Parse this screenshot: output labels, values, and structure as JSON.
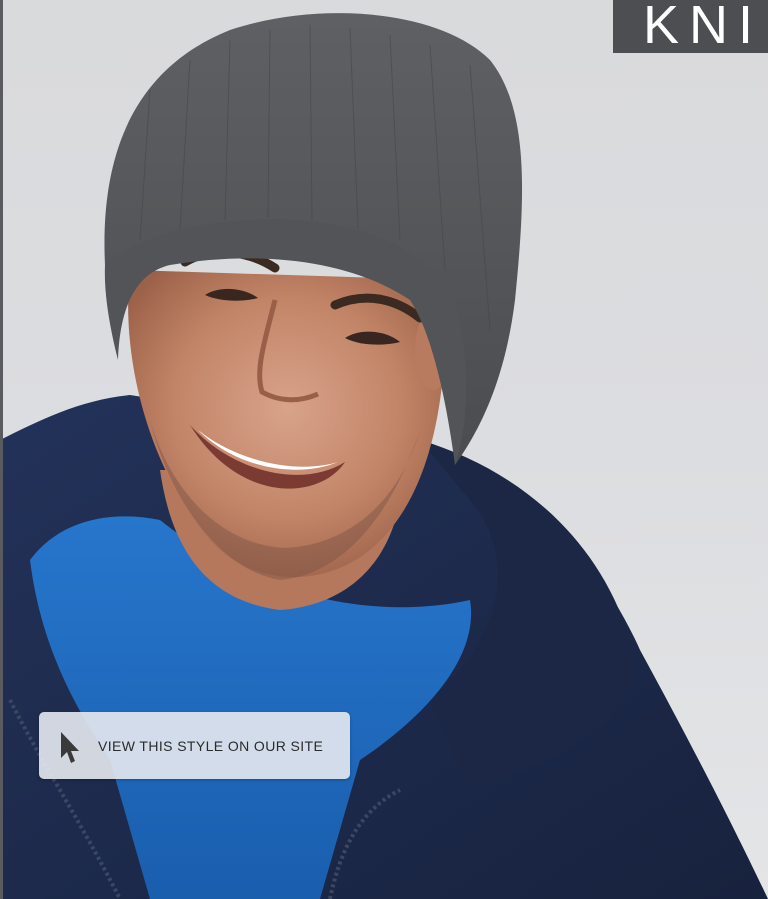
{
  "banner": {
    "corner_label": "KNI",
    "corner_color": "#4d4e51",
    "background_color": "#dcdde0"
  },
  "photo": {
    "subject": "smiling man wearing grey knit beanie, navy hoodie, royal blue shirt",
    "hat_color": "#57595b",
    "hoodie_color": "#1e2b4a",
    "shirt_color": "#1f66b8"
  },
  "cta": {
    "label": "VIEW THIS STYLE ON OUR SITE",
    "icon": "cursor-arrow-icon"
  }
}
